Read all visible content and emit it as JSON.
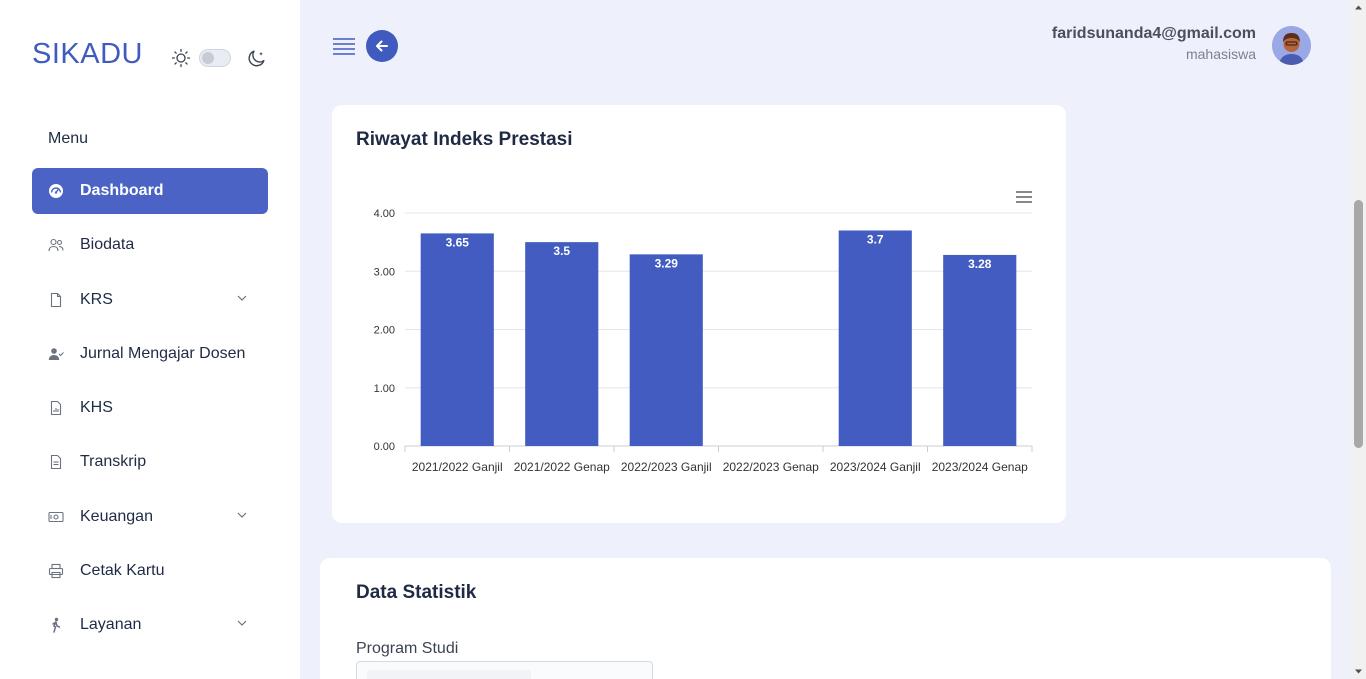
{
  "brand": "SIKADU",
  "sidebar": {
    "menu_title": "Menu",
    "items": [
      {
        "label": "Dashboard",
        "icon": "dashboard-icon",
        "active": true
      },
      {
        "label": "Biodata",
        "icon": "users-icon"
      },
      {
        "label": "KRS",
        "icon": "file-icon",
        "has_children": true
      },
      {
        "label": "Jurnal Mengajar Dosen",
        "icon": "user-check-icon"
      },
      {
        "label": "KHS",
        "icon": "report-icon"
      },
      {
        "label": "Transkrip",
        "icon": "document-icon"
      },
      {
        "label": "Keuangan",
        "icon": "money-icon",
        "has_children": true
      },
      {
        "label": "Cetak Kartu",
        "icon": "printer-icon"
      },
      {
        "label": "Layanan",
        "icon": "walk-icon",
        "has_children": true
      }
    ]
  },
  "header": {
    "user_email": "faridsunanda4@gmail.com",
    "user_role": "mahasiswa"
  },
  "chart_card": {
    "title": "Riwayat Indeks Prestasi"
  },
  "chart_data": {
    "type": "bar",
    "title": "Riwayat Indeks Prestasi",
    "categories": [
      "2021/2022 Ganjil",
      "2021/2022 Genap",
      "2022/2023 Ganjil",
      "2022/2023 Genap",
      "2023/2024 Ganjil",
      "2023/2024 Genap"
    ],
    "values": [
      3.65,
      3.5,
      3.29,
      null,
      3.7,
      3.28
    ],
    "data_labels": [
      "3.65",
      "3.5",
      "3.29",
      "",
      "3.7",
      "3.28"
    ],
    "ylim": [
      0,
      4
    ],
    "yticks": [
      "0.00",
      "1.00",
      "2.00",
      "3.00",
      "4.00"
    ],
    "xlabel": "",
    "ylabel": "",
    "grid": true,
    "bar_color": "#435cc2"
  },
  "stats_card": {
    "title": "Data Statistik",
    "program_label": "Program Studi"
  },
  "colors": {
    "accent": "#4a63c4",
    "background": "#eef1fc"
  }
}
